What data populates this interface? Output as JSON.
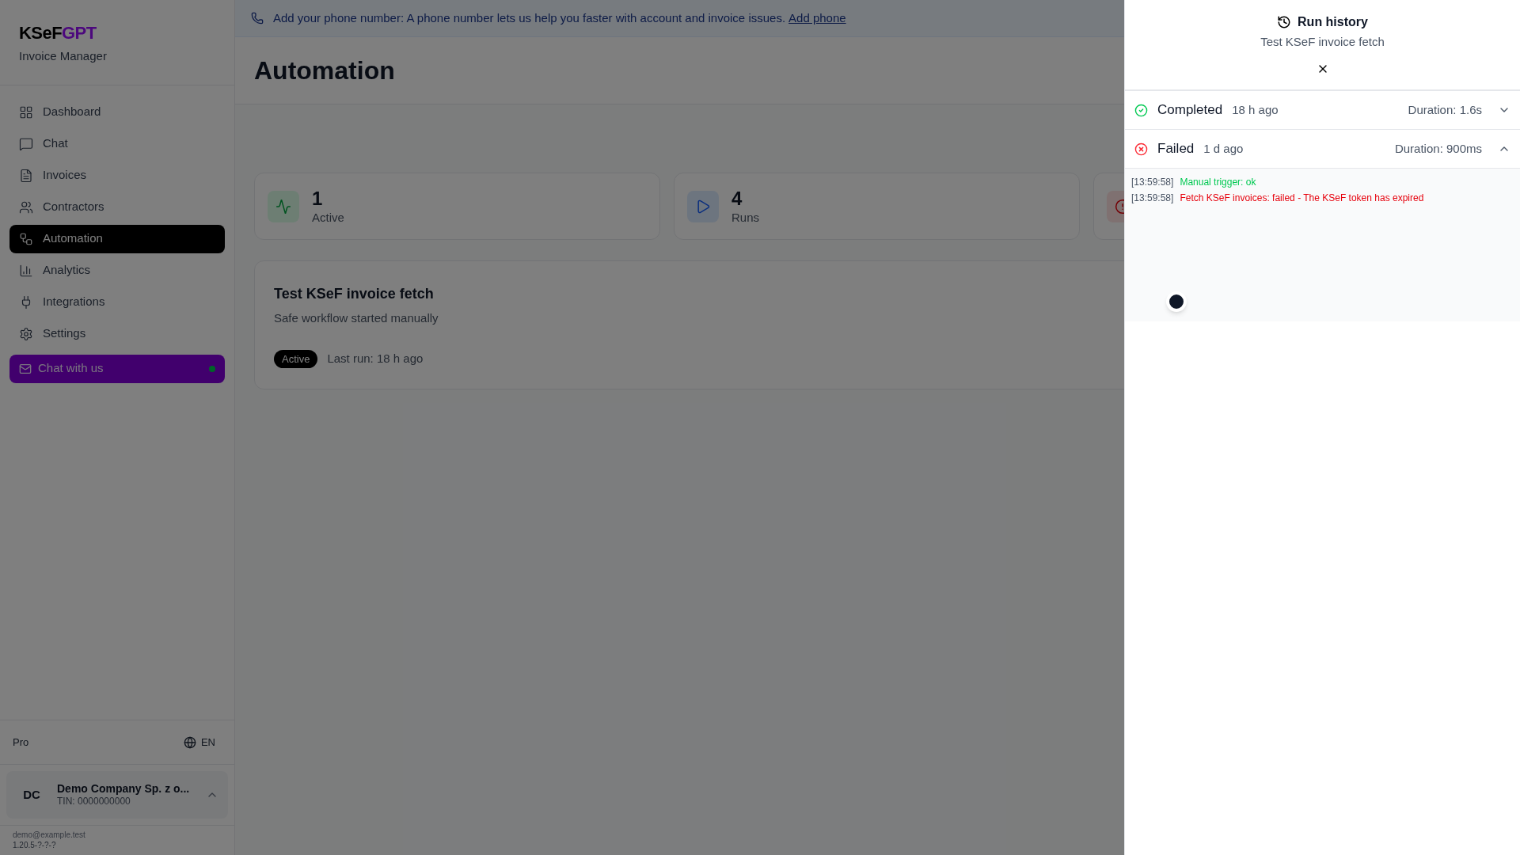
{
  "brand": {
    "name_main": "KSeF",
    "name_accent": "GPT",
    "subtitle": "Invoice Manager"
  },
  "sidebar": {
    "items": [
      {
        "label": "Dashboard",
        "selected": false
      },
      {
        "label": "Chat",
        "selected": false
      },
      {
        "label": "Invoices",
        "selected": false
      },
      {
        "label": "Contractors",
        "selected": false
      },
      {
        "label": "Automation",
        "selected": true
      },
      {
        "label": "Analytics",
        "selected": false
      },
      {
        "label": "Integrations",
        "selected": false
      },
      {
        "label": "Settings",
        "selected": false
      }
    ],
    "chat_button": {
      "label": "Chat with us",
      "online": true
    },
    "plan": "Pro",
    "language": "EN",
    "company": {
      "initials": "DC",
      "name": "Demo Company Sp. z o...",
      "tin": "TIN: 0000000000"
    },
    "footer": {
      "email": "demo@example.test",
      "version": "1.20.5-?-?-?"
    }
  },
  "banner": {
    "text": "Add your phone number: A phone number lets us help you faster with account and invoice issues.",
    "link": "Add phone"
  },
  "page": {
    "title": "Automation"
  },
  "stats": [
    {
      "kind": "active",
      "value": "1",
      "label": "Active"
    },
    {
      "kind": "runs",
      "value": "4",
      "label": "Runs"
    },
    {
      "kind": "errors"
    }
  ],
  "workflow": {
    "title": "Test KSeF invoice fetch",
    "description": "Safe workflow started manually",
    "status": "Active",
    "last_run": "Last run: 18 h ago"
  },
  "run_history": {
    "title": "Run history",
    "subtitle": "Test KSeF invoice fetch",
    "runs": [
      {
        "kind": "completed",
        "label": "Completed",
        "time": "18 h ago",
        "duration": "Duration: 1.6s",
        "expanded": false
      },
      {
        "kind": "failed",
        "label": "Failed",
        "time": "1 d ago",
        "duration": "Duration: 900ms",
        "expanded": true,
        "logs": [
          {
            "time": "[13:59:58]",
            "message": "Manual trigger: ok",
            "kind": "success"
          },
          {
            "time": "[13:59:58]",
            "message": "Fetch KSeF invoices: failed - The KSeF token has expired",
            "kind": "error"
          }
        ]
      }
    ]
  }
}
